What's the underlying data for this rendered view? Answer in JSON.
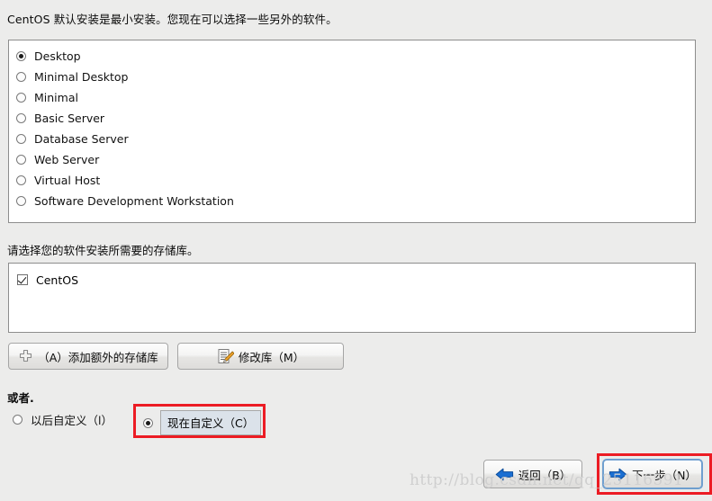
{
  "intro": {
    "text": "CentOS 默认安装是最小安装。您现在可以选择一些另外的软件。"
  },
  "software_groups": {
    "selected": "Desktop",
    "items": [
      {
        "label": "Desktop",
        "checked": true
      },
      {
        "label": "Minimal Desktop",
        "checked": false
      },
      {
        "label": "Minimal",
        "checked": false
      },
      {
        "label": "Basic Server",
        "checked": false
      },
      {
        "label": "Database Server",
        "checked": false
      },
      {
        "label": "Web Server",
        "checked": false
      },
      {
        "label": "Virtual Host",
        "checked": false
      },
      {
        "label": "Software Development Workstation",
        "checked": false
      }
    ]
  },
  "repositories": {
    "label": "请选择您的软件安装所需要的存储库。",
    "items": [
      {
        "label": "CentOS",
        "checked": true
      }
    ],
    "add_button": "（A）添加额外的存储库",
    "add_icon": "plus-icon",
    "modify_button": "修改库（M）",
    "modify_icon": "document-edit-icon"
  },
  "customize": {
    "or_label": "或者.",
    "later_label": "以后自定义（l）",
    "later_checked": false,
    "now_label": "现在自定义（C）",
    "now_checked": true
  },
  "navigation": {
    "back_label": "返回（B）",
    "back_icon": "arrow-left-icon",
    "next_label": "下一步（N）",
    "next_icon": "arrow-right-icon"
  },
  "watermark": {
    "text": "http://blog.csdn.net/qq_25116591"
  },
  "colors": {
    "background": "#ececeb",
    "panel_background": "#ffffff",
    "panel_border": "#8d8d8d",
    "highlight_red": "#ec1c24",
    "focus_blue": "#6f9fcf",
    "arrow_blue": "#1b6fd2",
    "pencil_orange": "#f0a32a"
  }
}
